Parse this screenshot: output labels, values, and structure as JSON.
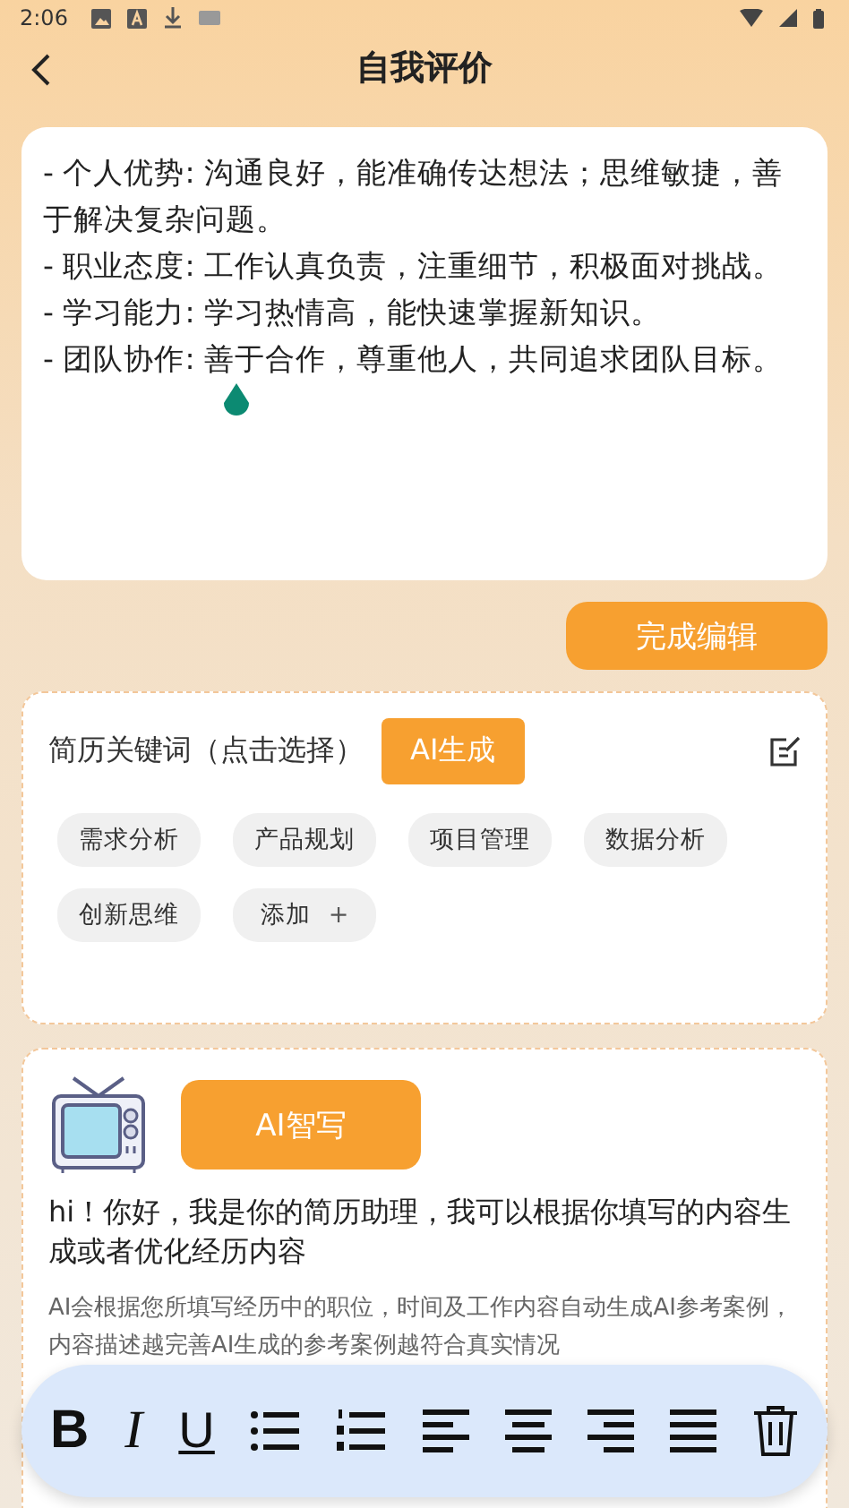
{
  "status_bar": {
    "time": "2:06"
  },
  "header": {
    "title": "自我评价"
  },
  "editor": {
    "lines": [
      "- 个人优势: 沟通良好，能准确传达想法；思维敏捷，善于解决复杂问题。",
      "- 职业态度: 工作认真负责，注重细节，积极面对挑战。",
      "- 学习能力: 学习热情高，能快速掌握新知识。",
      "- 团队协作: 善于合作，尊重他人，共同追求团队目标。"
    ]
  },
  "done_button": "完成编辑",
  "keywords": {
    "title": "简历关键词（点击选择）",
    "ai_button": "AI生成",
    "chips": [
      {
        "kind": "keyword",
        "label": "需求分析"
      },
      {
        "kind": "keyword",
        "label": "产品规划"
      },
      {
        "kind": "keyword",
        "label": "项目管理"
      },
      {
        "kind": "keyword",
        "label": "数据分析"
      },
      {
        "kind": "keyword",
        "label": "创新思维"
      },
      {
        "kind": "add",
        "label": "添加",
        "symbol": "+"
      }
    ]
  },
  "ai_card": {
    "button": "AI智写",
    "greeting": "hi！你好，我是你的简历助理，我可以根据你填写的内容生成或者优化经历内容",
    "note": "AI会根据您所填写经历中的职位，时间及工作内容自动生成AI参考案例，内容描述越完善AI生成的参考案例越符合真实情况"
  },
  "toolbar": {
    "tools": [
      {
        "kind": "bold",
        "label": "B"
      },
      {
        "kind": "italic",
        "label": "I"
      },
      {
        "kind": "underline",
        "label": "U"
      },
      {
        "kind": "bullets"
      },
      {
        "kind": "numbers"
      },
      {
        "kind": "align-left"
      },
      {
        "kind": "align-center"
      },
      {
        "kind": "align-right"
      },
      {
        "kind": "justify"
      },
      {
        "kind": "delete"
      }
    ]
  }
}
